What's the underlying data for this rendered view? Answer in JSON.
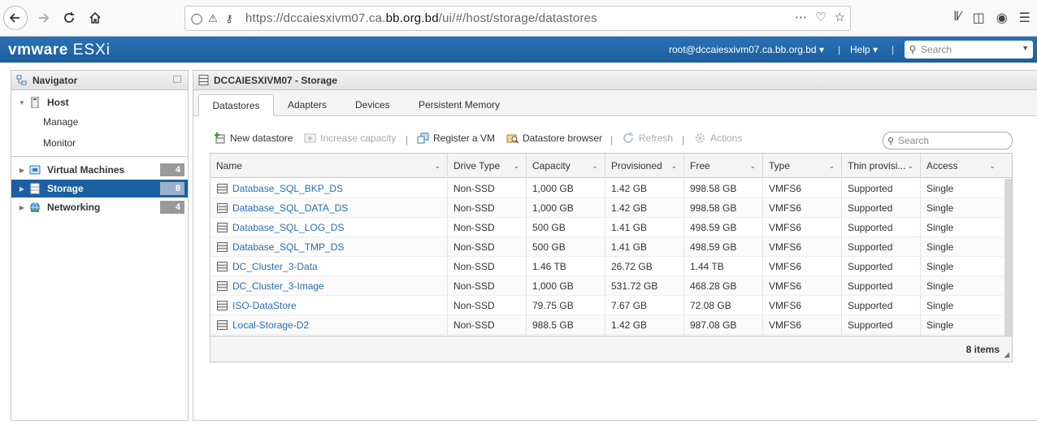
{
  "browser": {
    "url_prefix": "https://dccaiesxivm07.ca.",
    "url_domain": "bb.org.bd",
    "url_path": "/ui/#/host/storage/datastores"
  },
  "header": {
    "logo_vm": "vmware",
    "logo_product": "ESXi",
    "user": "root@dccaiesxivm07.ca.bb.org.bd",
    "help": "Help",
    "search_placeholder": "Search"
  },
  "navigator": {
    "title": "Navigator",
    "host_label": "Host",
    "host_children": [
      "Manage",
      "Monitor"
    ],
    "items": [
      {
        "label": "Virtual Machines",
        "count": "4"
      },
      {
        "label": "Storage",
        "count": "8"
      },
      {
        "label": "Networking",
        "count": "4"
      }
    ]
  },
  "main": {
    "title": "DCCAIESXIVM07 - Storage",
    "tabs": [
      "Datastores",
      "Adapters",
      "Devices",
      "Persistent Memory"
    ],
    "toolbar": {
      "new_datastore": "New datastore",
      "increase_capacity": "Increase capacity",
      "register_vm": "Register a VM",
      "datastore_browser": "Datastore browser",
      "refresh": "Refresh",
      "actions": "Actions"
    },
    "grid_search_placeholder": "Search",
    "columns": [
      "Name",
      "Drive Type",
      "Capacity",
      "Provisioned",
      "Free",
      "Type",
      "Thin provisi...",
      "Access"
    ],
    "rows": [
      [
        "Database_SQL_BKP_DS",
        "Non-SSD",
        "1,000 GB",
        "1.42 GB",
        "998.58 GB",
        "VMFS6",
        "Supported",
        "Single"
      ],
      [
        "Database_SQL_DATA_DS",
        "Non-SSD",
        "1,000 GB",
        "1.42 GB",
        "998.58 GB",
        "VMFS6",
        "Supported",
        "Single"
      ],
      [
        "Database_SQL_LOG_DS",
        "Non-SSD",
        "500 GB",
        "1.41 GB",
        "498.59 GB",
        "VMFS6",
        "Supported",
        "Single"
      ],
      [
        "Database_SQL_TMP_DS",
        "Non-SSD",
        "500 GB",
        "1.41 GB",
        "498.59 GB",
        "VMFS6",
        "Supported",
        "Single"
      ],
      [
        "DC_Cluster_3-Data",
        "Non-SSD",
        "1.46 TB",
        "26.72 GB",
        "1.44 TB",
        "VMFS6",
        "Supported",
        "Single"
      ],
      [
        "DC_Cluster_3-Image",
        "Non-SSD",
        "1,000 GB",
        "531.72 GB",
        "468.28 GB",
        "VMFS6",
        "Supported",
        "Single"
      ],
      [
        "ISO-DataStore",
        "Non-SSD",
        "79.75 GB",
        "7.67 GB",
        "72.08 GB",
        "VMFS6",
        "Supported",
        "Single"
      ],
      [
        "Local-Storage-D2",
        "Non-SSD",
        "988.5 GB",
        "1.42 GB",
        "987.08 GB",
        "VMFS6",
        "Supported",
        "Single"
      ]
    ],
    "footer_items": "8 items"
  },
  "colors": {
    "header_blue": "#1d5e9e",
    "active_nav": "#1b5fa3",
    "link": "#2a6eb0"
  }
}
